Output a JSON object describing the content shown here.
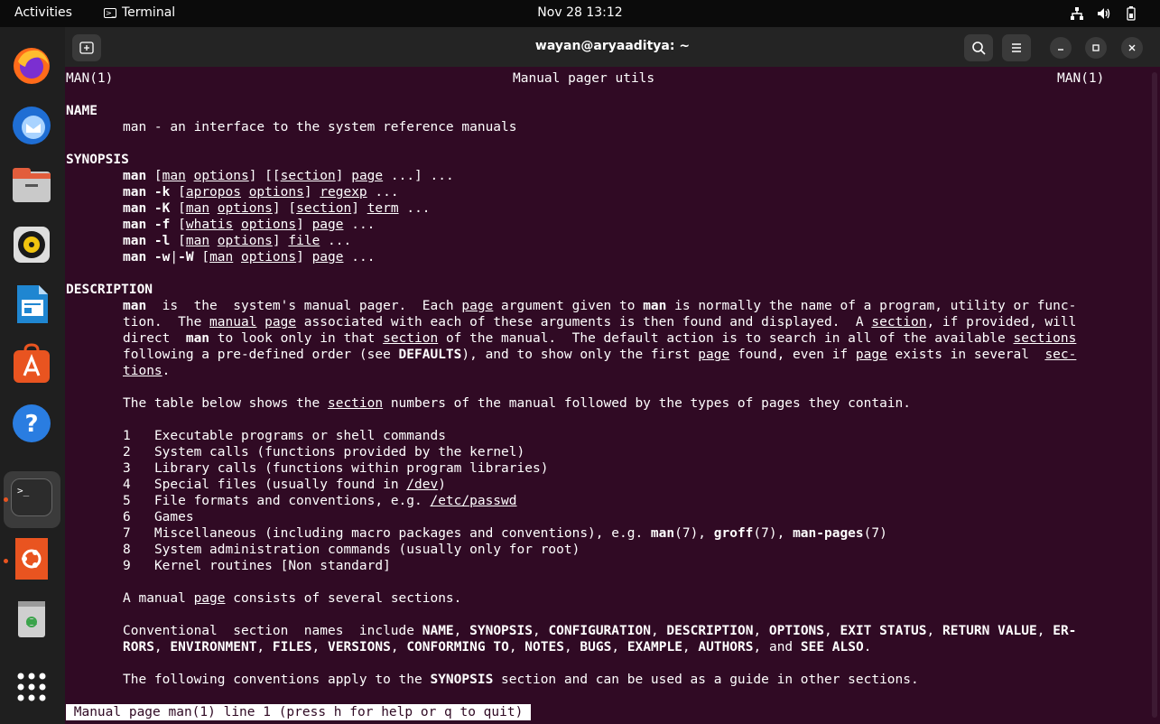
{
  "topbar": {
    "activities": "Activities",
    "app_name": "Terminal",
    "clock": "Nov 28  13:12"
  },
  "dock": {
    "items": [
      "Firefox",
      "Thunderbird",
      "Files",
      "Rhythmbox",
      "LibreOffice Writer",
      "Ubuntu Software",
      "Help",
      "Terminal",
      "Ubuntu",
      "Trash",
      "Show Applications"
    ]
  },
  "window": {
    "title": "wayan@aryaaditya: ~"
  },
  "terminal": {
    "header_left": "MAN(1)",
    "header_center": "Manual pager utils",
    "header_right": "MAN(1)",
    "name_heading": "NAME",
    "name_text": "man - an interface to the system reference manuals",
    "synopsis_heading": "SYNOPSIS",
    "description_heading": "DESCRIPTION",
    "table_intro_a": "The table below shows the ",
    "table_intro_b": "section",
    "table_intro_c": " numbers of the manual followed by the types of pages they contain.",
    "sections": [
      {
        "num": "1",
        "desc": "Executable programs or shell commands"
      },
      {
        "num": "2",
        "desc": "System calls (functions provided by the kernel)"
      },
      {
        "num": "3",
        "desc": "Library calls (functions within program libraries)"
      },
      {
        "num": "4",
        "desc": "Special files (usually found in /dev)"
      },
      {
        "num": "5",
        "desc": "File formats and conventions, e.g. /etc/passwd"
      },
      {
        "num": "6",
        "desc": "Games"
      },
      {
        "num": "7",
        "desc": "Miscellaneous (including macro packages and conventions), e.g. man(7), groff(7), man-pages(7)"
      },
      {
        "num": "8",
        "desc": "System administration commands (usually only for root)"
      },
      {
        "num": "9",
        "desc": "Kernel routines [Non standard]"
      }
    ],
    "manual_page_a": "A manual ",
    "manual_page_b": "page",
    "manual_page_c": " consists of several sections.",
    "conventions_line": "The following conventions apply to the SYNOPSIS section and can be used as a guide in other sections.",
    "status_bar": " Manual page man(1) line 1 (press h for help or q to quit) "
  }
}
